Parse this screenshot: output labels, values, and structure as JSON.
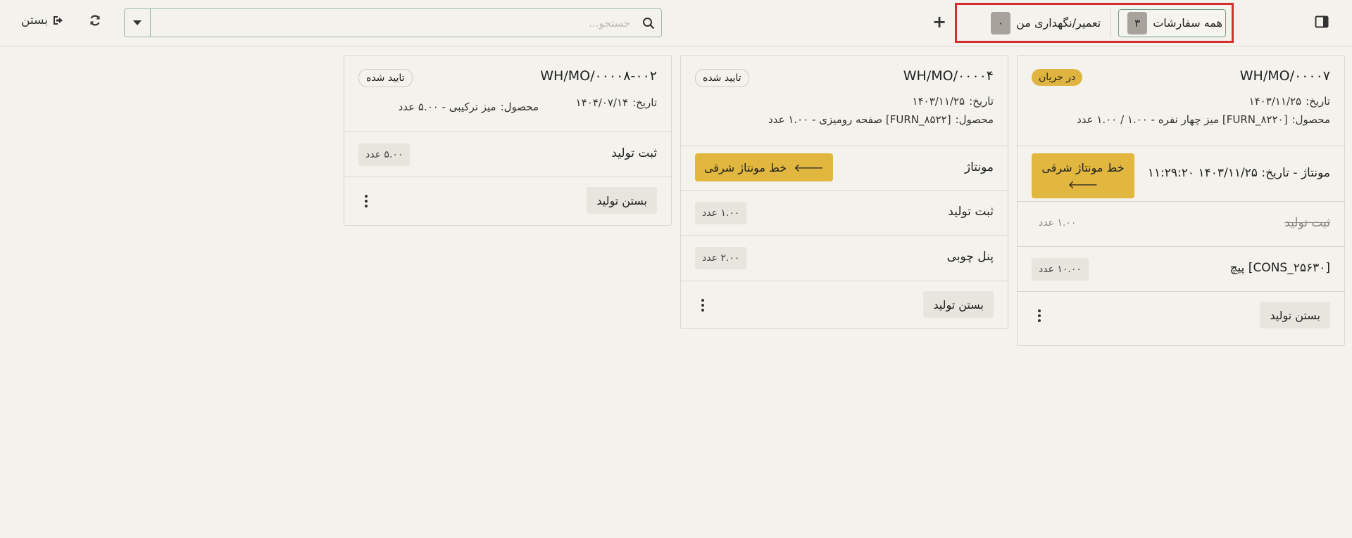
{
  "toolbar": {
    "close_label": "بستن",
    "search_placeholder": "جستجو...",
    "filters": [
      {
        "label": "همه سفارشات",
        "count": "۳",
        "active": true
      },
      {
        "label": "تعمیر/نگهداری من",
        "count": "۰",
        "active": false
      }
    ]
  },
  "icons": {
    "close": "sign-out-icon",
    "refresh": "refresh-icon",
    "search_dropdown": "caret-down-icon",
    "search": "search-icon",
    "add": "plus-icon",
    "sidebar": "sidebar-toggle-icon",
    "workcenter_arrow": "arrow-left-icon",
    "more": "vertical-ellipsis-icon"
  },
  "colors": {
    "background": "#f3f2ec",
    "accent_yellow": "#e2b73f",
    "highlight_red": "#d32f2f",
    "active_filter_border": "#6f9f8e"
  },
  "cards": [
    {
      "title": "WH/MO/۰۰۰۰۷",
      "status": "در جریان",
      "date_label": "تاریخ:",
      "date": "۱۴۰۳/۱۱/۲۵",
      "product_label": "محصول:",
      "product": "[FURN_۸۲۲۰] میز چهار نفره - ۱.۰۰ / ۱.۰۰ عدد",
      "operation": "مونتاژ  - تاریخ: ۱۴۰۳/۱۱/۲۵ ۱۱:۲۹:۲۰",
      "workcenter": "خط مونتاژ شرقی",
      "rows": [
        {
          "label": "ثبت تولید",
          "qty": "۱.۰۰ عدد",
          "done": true
        },
        {
          "label": "[CONS_۲۵۶۳۰] پیچ",
          "qty": "۱۰.۰۰ عدد",
          "done": false
        }
      ],
      "close_label": "بستن تولید"
    },
    {
      "title": "WH/MO/۰۰۰۰۴",
      "status": "تایید شده",
      "date_label": "تاریخ:",
      "date": "۱۴۰۳/۱۱/۲۵",
      "product_label": "محصول:",
      "product": "[FURN_۸۵۲۲] صفحه رومیزی - ۱.۰۰ عدد",
      "operation": "مونتاژ",
      "workcenter": "خط مونتاژ شرقی",
      "rows": [
        {
          "label": "ثبت تولید",
          "qty": "۱.۰۰ عدد",
          "done": false
        },
        {
          "label": "پنل چوبی",
          "qty": "۲.۰۰ عدد",
          "done": false
        }
      ],
      "close_label": "بستن تولید"
    },
    {
      "title": "WH/MO/۰۰۰۰۸-۰۰۲",
      "status": "تایید شده",
      "date_label": "تاریخ:",
      "date": "۱۴۰۴/۰۷/۱۴",
      "product_label": "محصول:",
      "product": "میز ترکیبی - ۵.۰۰ عدد",
      "rows": [
        {
          "label": "ثبت تولید",
          "qty": "۵.۰۰ عدد",
          "done": false
        }
      ],
      "close_label": "بستن تولید"
    }
  ]
}
